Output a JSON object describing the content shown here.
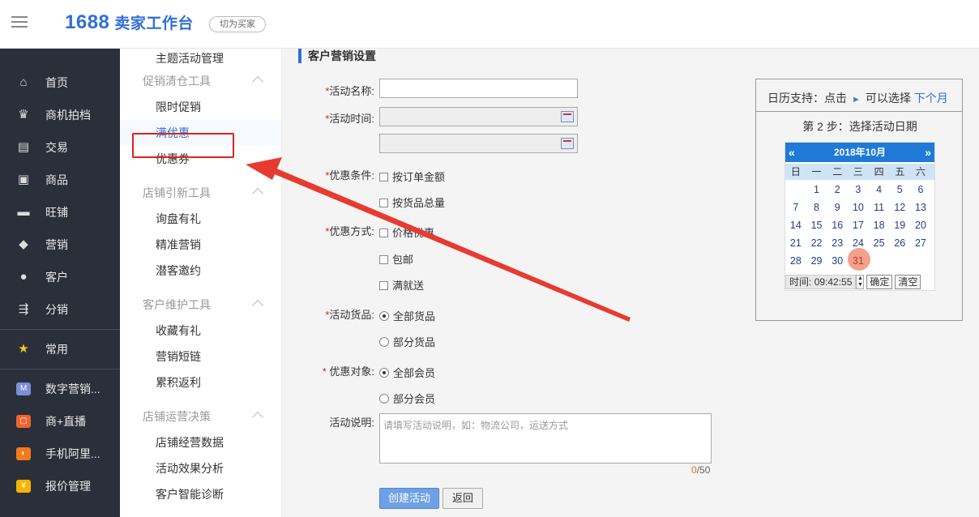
{
  "header": {
    "logo_num": "1688",
    "logo_text": "卖家工作台",
    "switch_label": "切为买家"
  },
  "leftnav": [
    {
      "label": "首页",
      "icon": "home-icon",
      "glyph": "⌂"
    },
    {
      "label": "商机拍档",
      "icon": "crown-icon",
      "glyph": "♛"
    },
    {
      "label": "交易",
      "icon": "clipboard-icon",
      "glyph": "▤"
    },
    {
      "label": "商品",
      "icon": "box-icon",
      "glyph": "▣"
    },
    {
      "label": "旺铺",
      "icon": "shop-icon",
      "glyph": "▬"
    },
    {
      "label": "营销",
      "icon": "tag-icon",
      "glyph": "◆"
    },
    {
      "label": "客户",
      "icon": "user-icon",
      "glyph": "●"
    },
    {
      "label": "分销",
      "icon": "share-icon",
      "glyph": "⇶"
    },
    {
      "label": "常用",
      "icon": "star-icon",
      "glyph": "★"
    },
    {
      "label": "数字营销...",
      "icon": "app-digital-icon",
      "glyph": "M",
      "color": "#7a8fd8"
    },
    {
      "label": "商+直播",
      "icon": "app-live-icon",
      "glyph": "▢",
      "color": "#f0632e"
    },
    {
      "label": "手机阿里...",
      "icon": "app-mobile-icon",
      "glyph": "◐",
      "color": "#f27a1a"
    },
    {
      "label": "报价管理",
      "icon": "app-quote-icon",
      "glyph": "¥",
      "color": "#f5b400"
    }
  ],
  "submenu": {
    "top_link": "主题活动管理",
    "groups": [
      {
        "title": "促销清仓工具",
        "links": [
          "限时促销",
          "满优惠",
          "优惠券"
        ]
      },
      {
        "title": "店铺引新工具",
        "links": [
          "询盘有礼",
          "精准营销",
          "潜客邀约"
        ]
      },
      {
        "title": "客户维护工具",
        "links": [
          "收藏有礼",
          "营销短链",
          "累积返利"
        ]
      },
      {
        "title": "店铺运营决策",
        "links": [
          "店铺经营数据",
          "活动效果分析",
          "客户智能诊断"
        ]
      }
    ],
    "active": "满优惠"
  },
  "form": {
    "section_title": "客户营销设置",
    "name_label": "活动名称:",
    "name_value": "",
    "time_label": "活动时间:",
    "start_value": "",
    "end_value": "",
    "cond_label": "优惠条件:",
    "cond_opts": [
      "按订单金额",
      "按货品总量"
    ],
    "method_label": "优惠方式:",
    "method_opts": [
      "价格优惠",
      "包邮",
      "满就送"
    ],
    "goods_label": "活动货品:",
    "goods_opts": [
      "全部货品",
      "部分货品"
    ],
    "target_label": "优惠对象:",
    "target_opts": [
      "全部会员",
      "部分会员"
    ],
    "desc_label": "活动说明:",
    "desc_placeholder": "请填写活动说明，如：物流公司，运送方式",
    "count_cur": "0",
    "count_max": "/50",
    "submit_label": "创建活动",
    "back_label": "返回"
  },
  "cal_help": {
    "intro": "日历支持：点击",
    "intro2": "可以选择",
    "next_link": "下个月",
    "step": "第 2 步：选择活动日期",
    "month": "2018年10月",
    "prev": "«",
    "next": "»",
    "weekdays": [
      "日",
      "一",
      "二",
      "三",
      "四",
      "五",
      "六"
    ],
    "days": [
      "",
      "1",
      "2",
      "3",
      "4",
      "5",
      "6",
      "7",
      "8",
      "9",
      "10",
      "11",
      "12",
      "13",
      "14",
      "15",
      "16",
      "17",
      "18",
      "19",
      "20",
      "21",
      "22",
      "23",
      "24",
      "25",
      "26",
      "27",
      "28",
      "29",
      "30",
      "31"
    ],
    "today": "31",
    "time_label": "时间:",
    "time_value": "09:42:55",
    "confirm": "确定",
    "clear": "清空"
  },
  "colors": {
    "accent": "#2f6fd6",
    "nav_bg": "#2b2f3a",
    "annotation": "#e02020"
  }
}
